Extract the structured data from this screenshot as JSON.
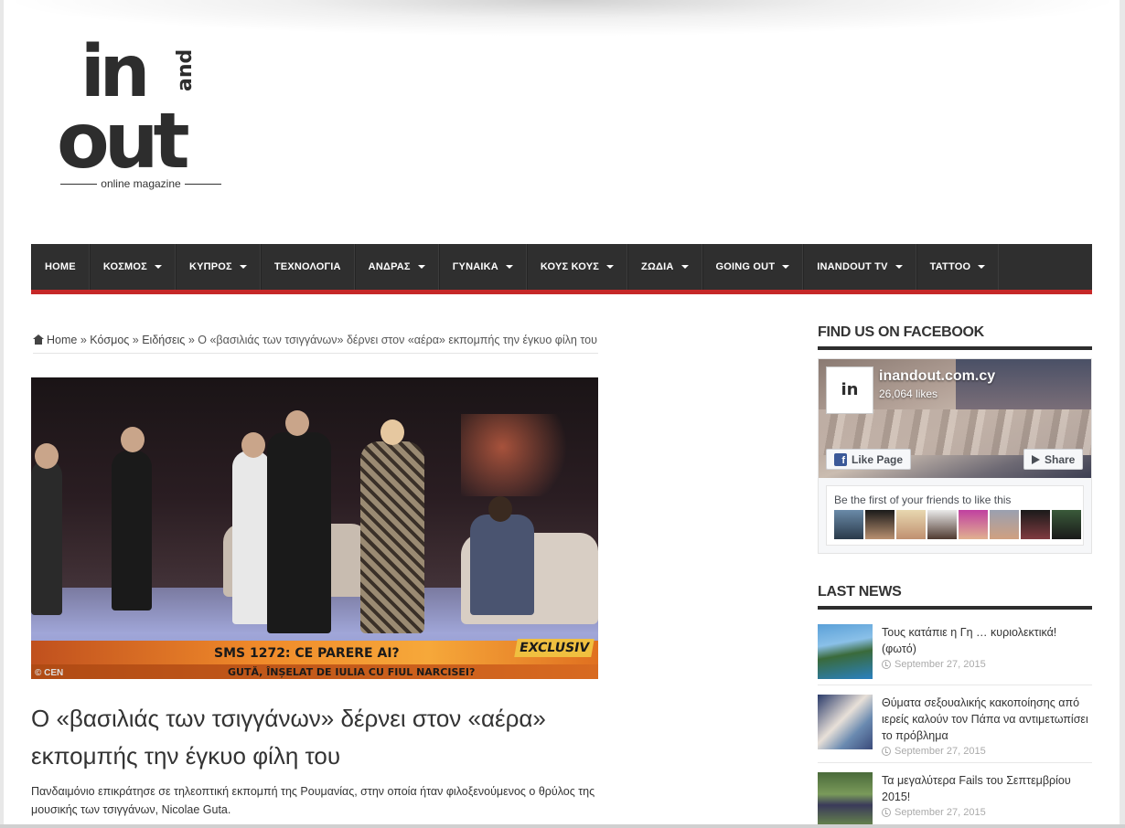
{
  "logo": {
    "word_in": "in",
    "word_and": "and",
    "word_out": "out",
    "tagline": "online magazine"
  },
  "nav": {
    "items": [
      {
        "label": "HOME",
        "has_menu": false
      },
      {
        "label": "ΚΟΣΜΟΣ",
        "has_menu": true
      },
      {
        "label": "ΚΥΠΡΟΣ",
        "has_menu": true
      },
      {
        "label": "ΤΕΧΝΟΛΟΓΙΑ",
        "has_menu": false
      },
      {
        "label": "ΑΝΔΡΑΣ",
        "has_menu": true
      },
      {
        "label": "ΓΥΝΑΙΚΑ",
        "has_menu": true
      },
      {
        "label": "ΚΟΥΣ ΚΟΥΣ",
        "has_menu": true
      },
      {
        "label": "ΖΩΔΙΑ",
        "has_menu": true
      },
      {
        "label": "GOING OUT",
        "has_menu": true
      },
      {
        "label": "INANDOUT TV",
        "has_menu": true
      },
      {
        "label": "TATTOO",
        "has_menu": true
      }
    ],
    "accent_color": "#c62828",
    "background_color": "#2f2f2f"
  },
  "breadcrumb": {
    "home": "Home",
    "separator": "»",
    "level1": "Κόσμος",
    "level2": "Ειδήσεις",
    "current": "Ο «βασιλιάς των τσιγγάνων» δέρνει στον «αέρα» εκπομπής την έγκυο φίλη του"
  },
  "article": {
    "image_overlay": {
      "sms_text": "SMS 1272: CE PARERE AI?",
      "exclusiv": "EXCLUSIV",
      "ticker": "GUTĂ, ÎNȘELAT DE IULIA CU FIUL NARCISEI?",
      "watermark": "© CEN"
    },
    "title": "Ο «βασιλιάς των τσιγγάνων» δέρνει στον «αέρα» εκπομπής την έγκυο φίλη του",
    "excerpt": "Πανδαιμόνιο επικράτησε σε τηλεοπτική εκπομπή της Ρουμανίας, στην οποία ήταν φιλοξενούμενος ο θρύλος της μουσικής των τσιγγάνων, Nicolae Guta."
  },
  "sidebar": {
    "facebook": {
      "heading": "FIND US ON FACEBOOK",
      "page_name": "inandout.com.cy",
      "likes": "26,064 likes",
      "like_button": "Like Page",
      "share_button": "Share",
      "friends_text": "Be the first of your friends to like this",
      "brand_color": "#3b5998"
    },
    "last_news": {
      "heading": "LAST NEWS",
      "items": [
        {
          "title": "Τους κατάπιε η Γη … κυριολεκτικά! (φωτό)",
          "date": "September 27, 2015"
        },
        {
          "title": "Θύματα σεξουαλικής κακοποίησης από ιερείς καλούν τον Πάπα να αντιμετωπίσει το πρόβλημα",
          "date": "September 27, 2015"
        },
        {
          "title": "Τα μεγαλύτερα Fails του Σεπτεμβρίου 2015!",
          "date": "September 27, 2015"
        }
      ]
    }
  }
}
